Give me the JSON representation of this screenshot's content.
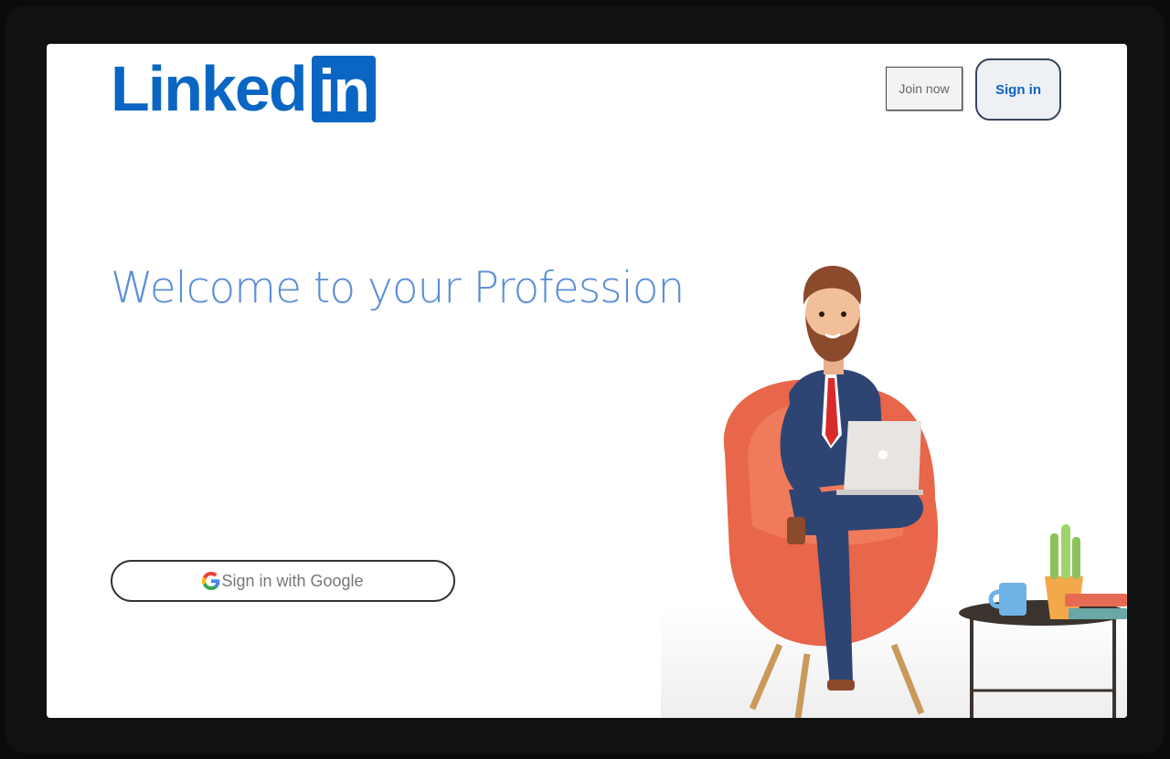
{
  "brand": {
    "logo_word": "Linked",
    "logo_badge": "in",
    "color": "#0a66c2"
  },
  "header": {
    "join_label": "Join now",
    "signin_label": "Sign in"
  },
  "hero": {
    "headline": "Welcome to your Profession",
    "headline_color": "#5b8ed6"
  },
  "google": {
    "label": "Sign in with Google",
    "icon": "google-g-icon"
  },
  "illustration": {
    "icon": "businessman-in-armchair-with-laptop"
  }
}
